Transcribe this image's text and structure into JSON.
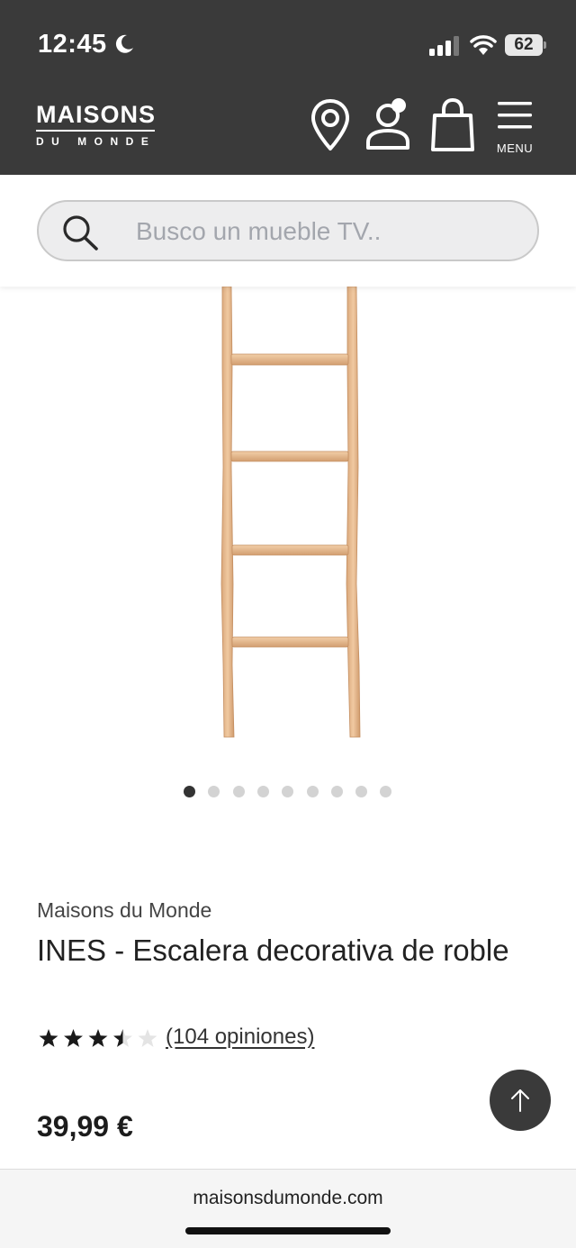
{
  "status_bar": {
    "time": "12:45",
    "battery": "62"
  },
  "header": {
    "logo_main": "MAISONS",
    "logo_sub": "DU MONDE",
    "menu_label": "MENU"
  },
  "search": {
    "placeholder": "Busco un mueble TV.."
  },
  "carousel": {
    "total_images": 9,
    "active_index": 0
  },
  "product": {
    "brand": "Maisons du Monde",
    "title": "INES - Escalera decorativa de roble",
    "rating": 3.5,
    "rating_max": 5,
    "reviews_label": "(104 opiniones)",
    "price": "39,99 €"
  },
  "browser": {
    "url": "maisonsdumonde.com"
  },
  "colors": {
    "header_bg": "#3a3a3a",
    "wood": "#e8b98c"
  }
}
